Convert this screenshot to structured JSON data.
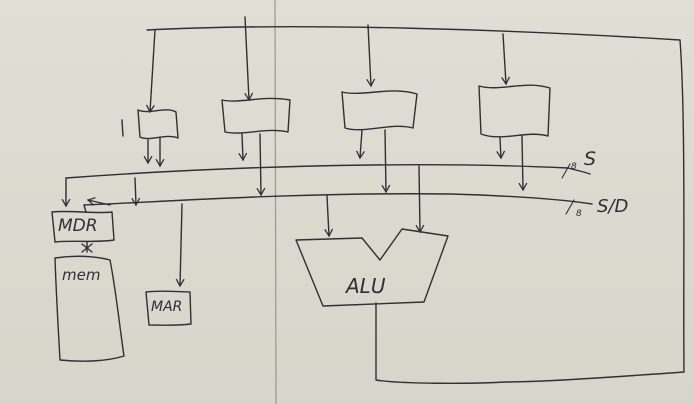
{
  "diagram": {
    "blocks": {
      "mdr": "MDR",
      "memory": "mem",
      "mar": "MAR",
      "alu": "ALU"
    },
    "buses": {
      "upper_bus_label": "S",
      "upper_bus_width": "8",
      "lower_bus_label": "S/D",
      "lower_bus_width": "8"
    },
    "ink_color": "#2f2f38",
    "board_color": "#dcd9cf"
  }
}
